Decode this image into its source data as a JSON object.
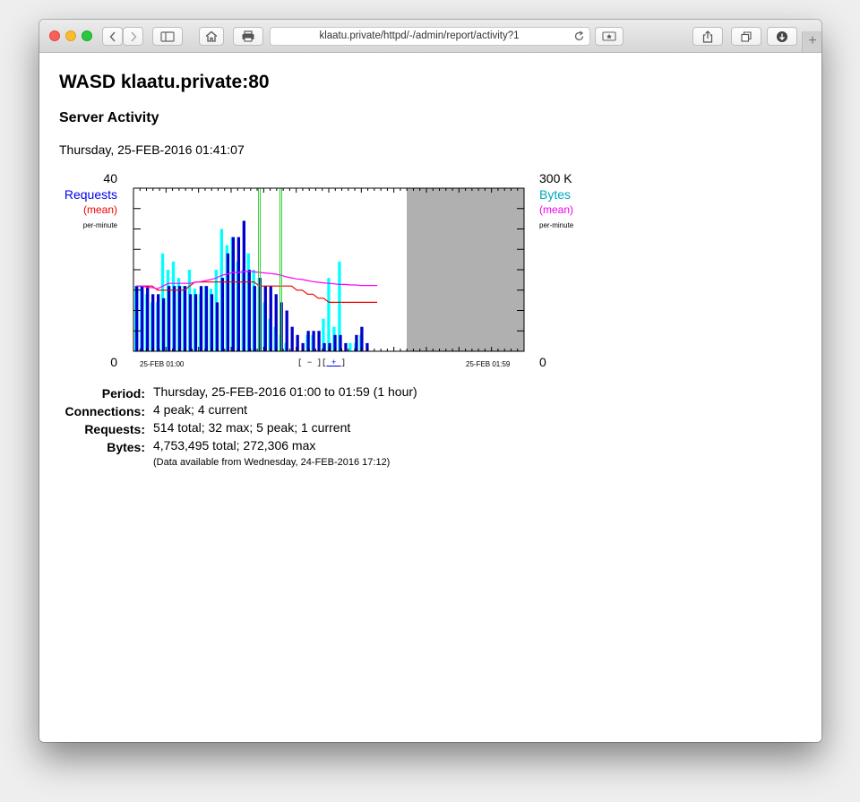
{
  "browser": {
    "url": "klaatu.private/httpd/-/admin/report/activity?1",
    "buttons": [
      "back",
      "forward",
      "sidebar",
      "home",
      "print",
      "reload",
      "reader",
      "share",
      "tabs",
      "downloads",
      "new-tab"
    ],
    "new_tab_label": "+"
  },
  "page": {
    "title": "WASD klaatu.private:80",
    "subtitle": "Server Activity",
    "datetime": "Thursday, 25-FEB-2016 01:41:07"
  },
  "chart_labels": {
    "left_max": "40",
    "left_min": "0",
    "left_series": "Requests",
    "left_mean": "(mean)",
    "left_unit": "per-minute",
    "right_max": "300 K",
    "right_min": "0",
    "right_series": "Bytes",
    "right_mean": "(mean)",
    "right_unit": "per-minute",
    "x_start": "25-FEB 01:00",
    "x_end": "25-FEB 01:59",
    "zoom_out_label": "[ − ]",
    "zoom_in_open": "[",
    "zoom_in_label": " + ",
    "zoom_in_close": "]"
  },
  "chart_data": {
    "type": "bar",
    "x": [
      0,
      1,
      2,
      3,
      4,
      5,
      6,
      7,
      8,
      9,
      10,
      11,
      12,
      13,
      14,
      15,
      16,
      17,
      18,
      19,
      20,
      21,
      22,
      23,
      24,
      25,
      26,
      27,
      28,
      29,
      30,
      31,
      32,
      33,
      34,
      35,
      36,
      37,
      38,
      39,
      40,
      41,
      42,
      43,
      44,
      45,
      46,
      47,
      48,
      49,
      50
    ],
    "ylim": [
      0,
      40
    ],
    "y2lim": [
      0,
      300000
    ],
    "series": [
      {
        "name": "Requests",
        "color": "#0000cc",
        "values": [
          16,
          16,
          16,
          14,
          14,
          13,
          16,
          16,
          16,
          16,
          14,
          14,
          16,
          16,
          14,
          12,
          18,
          24,
          28,
          28,
          32,
          20,
          16,
          18,
          16,
          16,
          14,
          12,
          10,
          6,
          4,
          2,
          5,
          5,
          5,
          2,
          2,
          4,
          4,
          2,
          0,
          4,
          6,
          2,
          0,
          0,
          0,
          0,
          0,
          0,
          0
        ]
      },
      {
        "name": "Bytes",
        "color": "#00ffff",
        "values": [
          120000,
          120000,
          105000,
          90000,
          90000,
          180000,
          150000,
          165000,
          135000,
          120000,
          150000,
          115000,
          105000,
          120000,
          115000,
          150000,
          225000,
          195000,
          210000,
          165000,
          150000,
          180000,
          150000,
          135000,
          90000,
          60000,
          45000,
          30000,
          15000,
          0,
          0,
          0,
          30000,
          30000,
          0,
          60000,
          135000,
          45000,
          165000,
          0,
          15000,
          15000,
          30000,
          0,
          0,
          0,
          0,
          0,
          0,
          0,
          0
        ]
      },
      {
        "name": "Requests (mean)",
        "color": "#ee0000",
        "values": [
          16,
          16,
          16,
          16,
          15,
          15,
          15,
          15,
          15,
          15,
          16,
          17,
          17,
          17,
          17,
          17,
          17,
          17,
          17,
          17,
          17,
          17,
          17,
          16,
          16,
          16,
          16,
          16,
          16,
          16,
          15,
          15,
          14,
          14,
          13,
          13,
          12,
          12,
          12,
          12,
          12,
          12,
          12,
          12,
          12,
          12,
          null,
          null,
          null,
          null,
          null
        ]
      },
      {
        "name": "Bytes (mean)",
        "color": "#ff00ff",
        "values": [
          120000,
          120000,
          118000,
          117000,
          115000,
          120000,
          125000,
          125000,
          125000,
          125000,
          125000,
          127000,
          128000,
          130000,
          132000,
          135000,
          140000,
          142000,
          145000,
          145000,
          146000,
          147000,
          146000,
          145000,
          144000,
          143000,
          142000,
          140000,
          137000,
          135000,
          133000,
          132000,
          130000,
          128000,
          127000,
          126000,
          125000,
          124000,
          123000,
          123000,
          122000,
          122000,
          121000,
          121000,
          121000,
          121000,
          null,
          null,
          null,
          null,
          null
        ]
      }
    ],
    "markers_minutes": [
      23,
      27
    ],
    "marker_color": "#33cc33",
    "no_data_from_minute": 36,
    "no_data_color": "#b0b0b0"
  },
  "summary": {
    "period_label": "Period:",
    "period_value": "Thursday, 25-FEB-2016 01:00 to 01:59  (1 hour)",
    "connections_label": "Connections:",
    "connections_value": "4 peak;  4 current",
    "requests_label": "Requests:",
    "requests_value": "514 total;  32 max;  5 peak;  1 current",
    "bytes_label": "Bytes:",
    "bytes_value": "4,753,495 total;  272,306 max",
    "note": "(Data available from Wednesday, 24-FEB-2016 17:12)"
  },
  "colors": {
    "requests": "#0000cc",
    "bytes": "#00cccc",
    "req_mean": "#ee0000",
    "bytes_mean": "#ff00ff"
  }
}
